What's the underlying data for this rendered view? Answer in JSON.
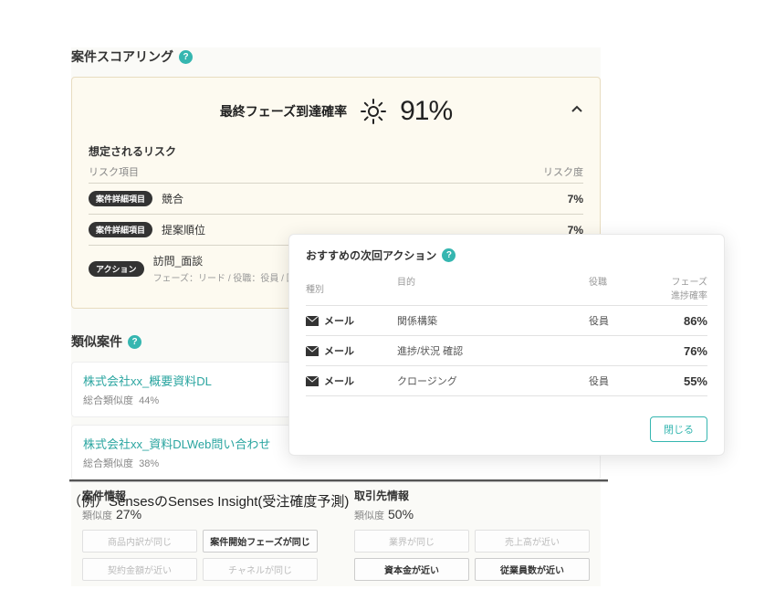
{
  "scoring": {
    "title": "案件スコアリング",
    "prob_label": "最終フェーズ到達確率",
    "prob_value": "91%",
    "risk_heading": "想定されるリスク",
    "columns": {
      "item": "リスク項目",
      "degree": "リスク度"
    },
    "risks": [
      {
        "pill": "案件詳細項目",
        "name": "競合",
        "value": "7%"
      },
      {
        "pill": "案件詳細項目",
        "name": "提案順位",
        "value": "7%"
      }
    ],
    "action": {
      "pill": "アクション",
      "name": "訪問_面談",
      "sub": "フェーズ：リード / 役職：役員 / 回"
    }
  },
  "similar": {
    "title": "類似案件",
    "items": [
      {
        "name": "株式会社xx_概要資料DL",
        "sim_label": "総合類似度",
        "sim": "44%"
      },
      {
        "name": "株式会社xx_資料DLWeb問い合わせ",
        "sim_label": "総合類似度",
        "sim": "38%"
      }
    ],
    "case_info": {
      "title": "案件情報",
      "sim_label": "類似度",
      "sim": "27%",
      "tags": [
        {
          "label": "商品内訳が同じ",
          "active": false
        },
        {
          "label": "案件開始フェーズが同じ",
          "active": true
        },
        {
          "label": "契約金額が近い",
          "active": false
        },
        {
          "label": "チャネルが同じ",
          "active": false
        }
      ]
    },
    "client_info": {
      "title": "取引先情報",
      "sim_label": "類似度",
      "sim": "50%",
      "tags": [
        {
          "label": "業界が同じ",
          "active": false
        },
        {
          "label": "売上高が近い",
          "active": false
        },
        {
          "label": "資本金が近い",
          "active": true
        },
        {
          "label": "従業員数が近い",
          "active": true
        }
      ]
    }
  },
  "popup": {
    "title": "おすすめの次回アクション",
    "columns": {
      "type": "種別",
      "purpose": "目的",
      "role": "役職",
      "rate": "フェーズ\n進捗確率"
    },
    "rows": [
      {
        "type": "メール",
        "purpose": "関係構築",
        "role": "役員",
        "rate": "86%"
      },
      {
        "type": "メール",
        "purpose": "進捗/状況 確認",
        "role": "",
        "rate": "76%"
      },
      {
        "type": "メール",
        "purpose": "クロージング",
        "role": "役員",
        "rate": "55%"
      }
    ],
    "close": "閉じる"
  },
  "caption": "（例）SensesのSenses Insight(受注確度予測)"
}
